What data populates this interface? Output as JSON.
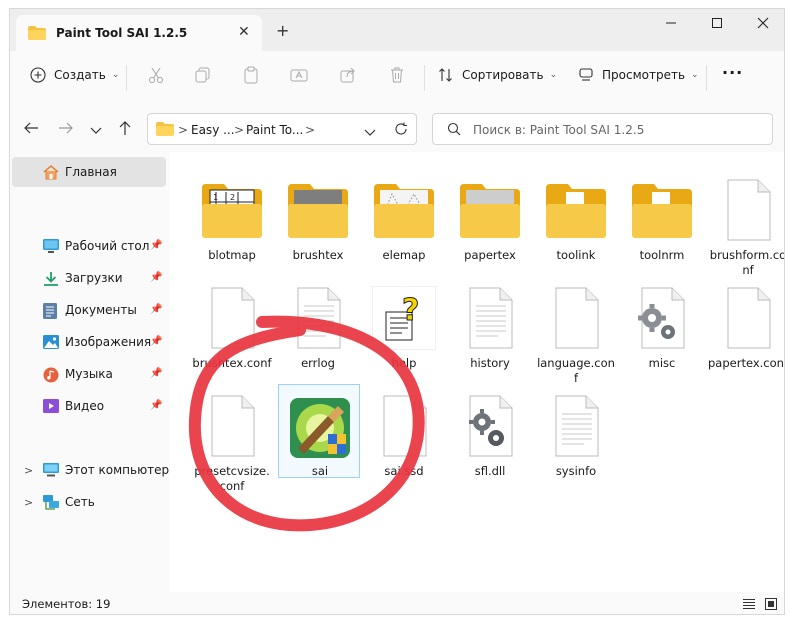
{
  "window": {
    "tab_title": "Paint Tool SAI 1.2.5",
    "new_tab_label": "+",
    "close_tab_label": "✕"
  },
  "toolbar": {
    "create_label": "Создать",
    "sort_label": "Сортировать",
    "view_label": "Просмотреть",
    "more_label": "···"
  },
  "address": {
    "seg1": "Easy ...",
    "seg2": "Paint To...",
    "sep": ">"
  },
  "search": {
    "placeholder": "Поиск в: Paint Tool SAI 1.2.5"
  },
  "sidebar": {
    "home": "Главная",
    "items": [
      {
        "label": "Рабочий стол",
        "icon": "desktop-icon"
      },
      {
        "label": "Загрузки",
        "icon": "download-icon"
      },
      {
        "label": "Документы",
        "icon": "documents-icon"
      },
      {
        "label": "Изображения",
        "icon": "pictures-icon"
      },
      {
        "label": "Музыка",
        "icon": "music-icon"
      },
      {
        "label": "Видео",
        "icon": "video-icon"
      }
    ],
    "this_pc": "Этот компьютер",
    "network": "Сеть"
  },
  "files": [
    {
      "name": "blotmap",
      "type": "folder"
    },
    {
      "name": "brushtex",
      "type": "folder"
    },
    {
      "name": "elemap",
      "type": "folder"
    },
    {
      "name": "papertex",
      "type": "folder"
    },
    {
      "name": "toolink",
      "type": "folder"
    },
    {
      "name": "toolnrm",
      "type": "folder"
    },
    {
      "name": "brushform.conf",
      "type": "file"
    },
    {
      "name": "brushtex.conf",
      "type": "file"
    },
    {
      "name": "errlog",
      "type": "text"
    },
    {
      "name": "help",
      "type": "help"
    },
    {
      "name": "history",
      "type": "text"
    },
    {
      "name": "language.conf",
      "type": "file"
    },
    {
      "name": "misc",
      "type": "gear"
    },
    {
      "name": "papertex.conf",
      "type": "file"
    },
    {
      "name": "presetcvsize.conf",
      "type": "file"
    },
    {
      "name": "sai",
      "type": "app"
    },
    {
      "name": "sai.ssd",
      "type": "file"
    },
    {
      "name": "sfl.dll",
      "type": "gear"
    },
    {
      "name": "sysinfo",
      "type": "text"
    }
  ],
  "status": {
    "count_text": "Элементов: 19"
  },
  "colors": {
    "folder": "#f5c342",
    "folder_dark": "#e8a915",
    "annotation_red": "#e8353f",
    "selection": "#99d1ff"
  }
}
